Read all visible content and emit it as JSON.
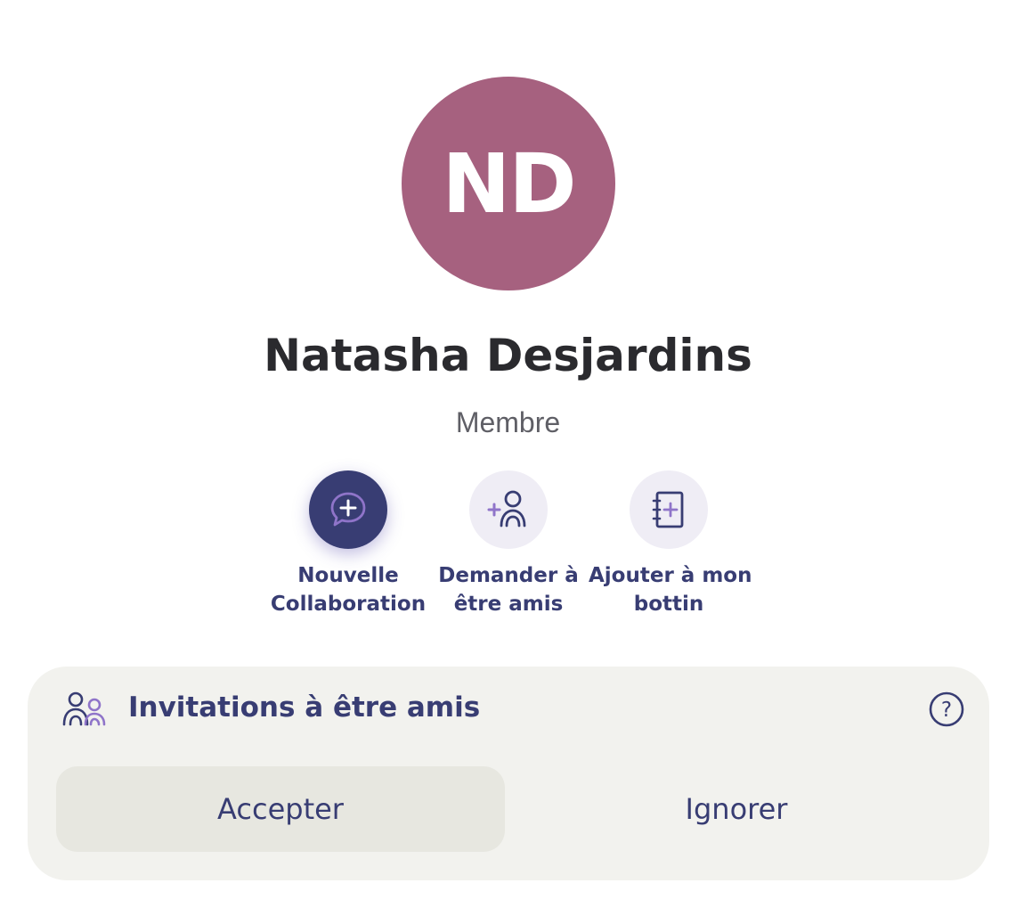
{
  "profile": {
    "initials": "ND",
    "avatar_color": "#a6617f",
    "name": "Natasha Desjardins",
    "role": "Membre"
  },
  "actions": [
    {
      "icon": "chat-plus-icon",
      "line1": "Nouvelle",
      "line2": "Collaboration"
    },
    {
      "icon": "add-friend-icon",
      "line1": "Demander à",
      "line2": "être amis"
    },
    {
      "icon": "address-book-add-icon",
      "line1": "Ajouter à mon",
      "line2": "bottin"
    }
  ],
  "invitation": {
    "icon": "people-icon",
    "title": "Invitations à être amis",
    "help_icon": "help-icon",
    "accept_label": "Accepter",
    "ignore_label": "Ignorer"
  },
  "colors": {
    "accent": "#383d73",
    "accent_light": "#8f74c9",
    "card_bg": "#f2f2ee"
  }
}
